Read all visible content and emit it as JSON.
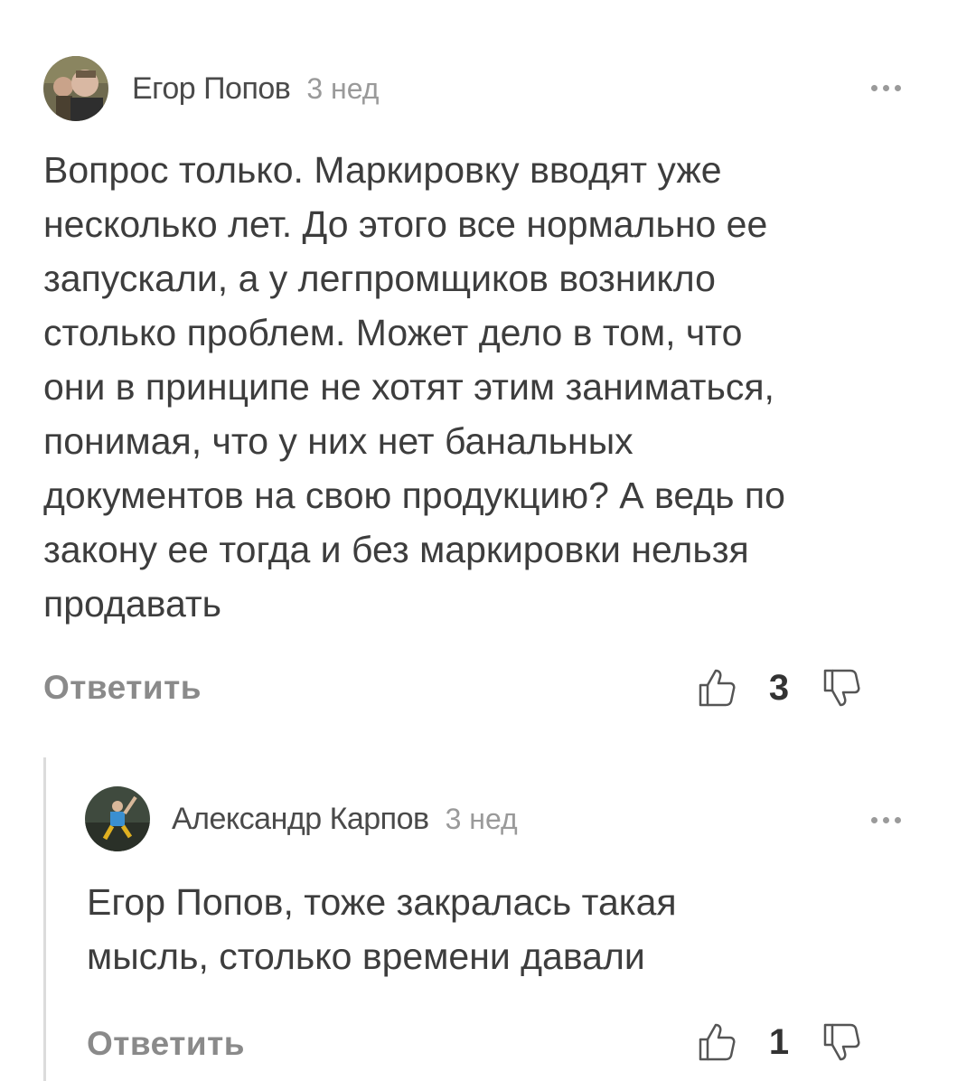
{
  "comments": [
    {
      "author": "Егор Попов",
      "time": "3 нед",
      "text": "Вопрос только. Маркировку вводят уже\nнесколько лет. До этого все нормально ее\nзапускали, а у легпромщиков возникло\nстолько проблем. Может дело в том, что\nони в принципе не хотят этим заниматься,\nпонимая, что у них нет банальных\nдокументов на свою продукцию? А ведь по\nзакону ее тогда и без маркировки нельзя\nпродавать",
      "reply_label": "Ответить",
      "likes": "3"
    },
    {
      "author": "Александр Карпов",
      "time": "3 нед",
      "text": "Егор Попов, тоже закралась такая\nмысль, столько времени давали",
      "reply_label": "Ответить",
      "likes": "1"
    }
  ],
  "icons": {
    "more": "more-dots-icon",
    "like": "thumb-up-icon",
    "dislike": "thumb-down-icon"
  },
  "colors": {
    "text": "#3d3d3d",
    "muted": "#9a9a9a",
    "thread_line": "#dcdcdc"
  }
}
